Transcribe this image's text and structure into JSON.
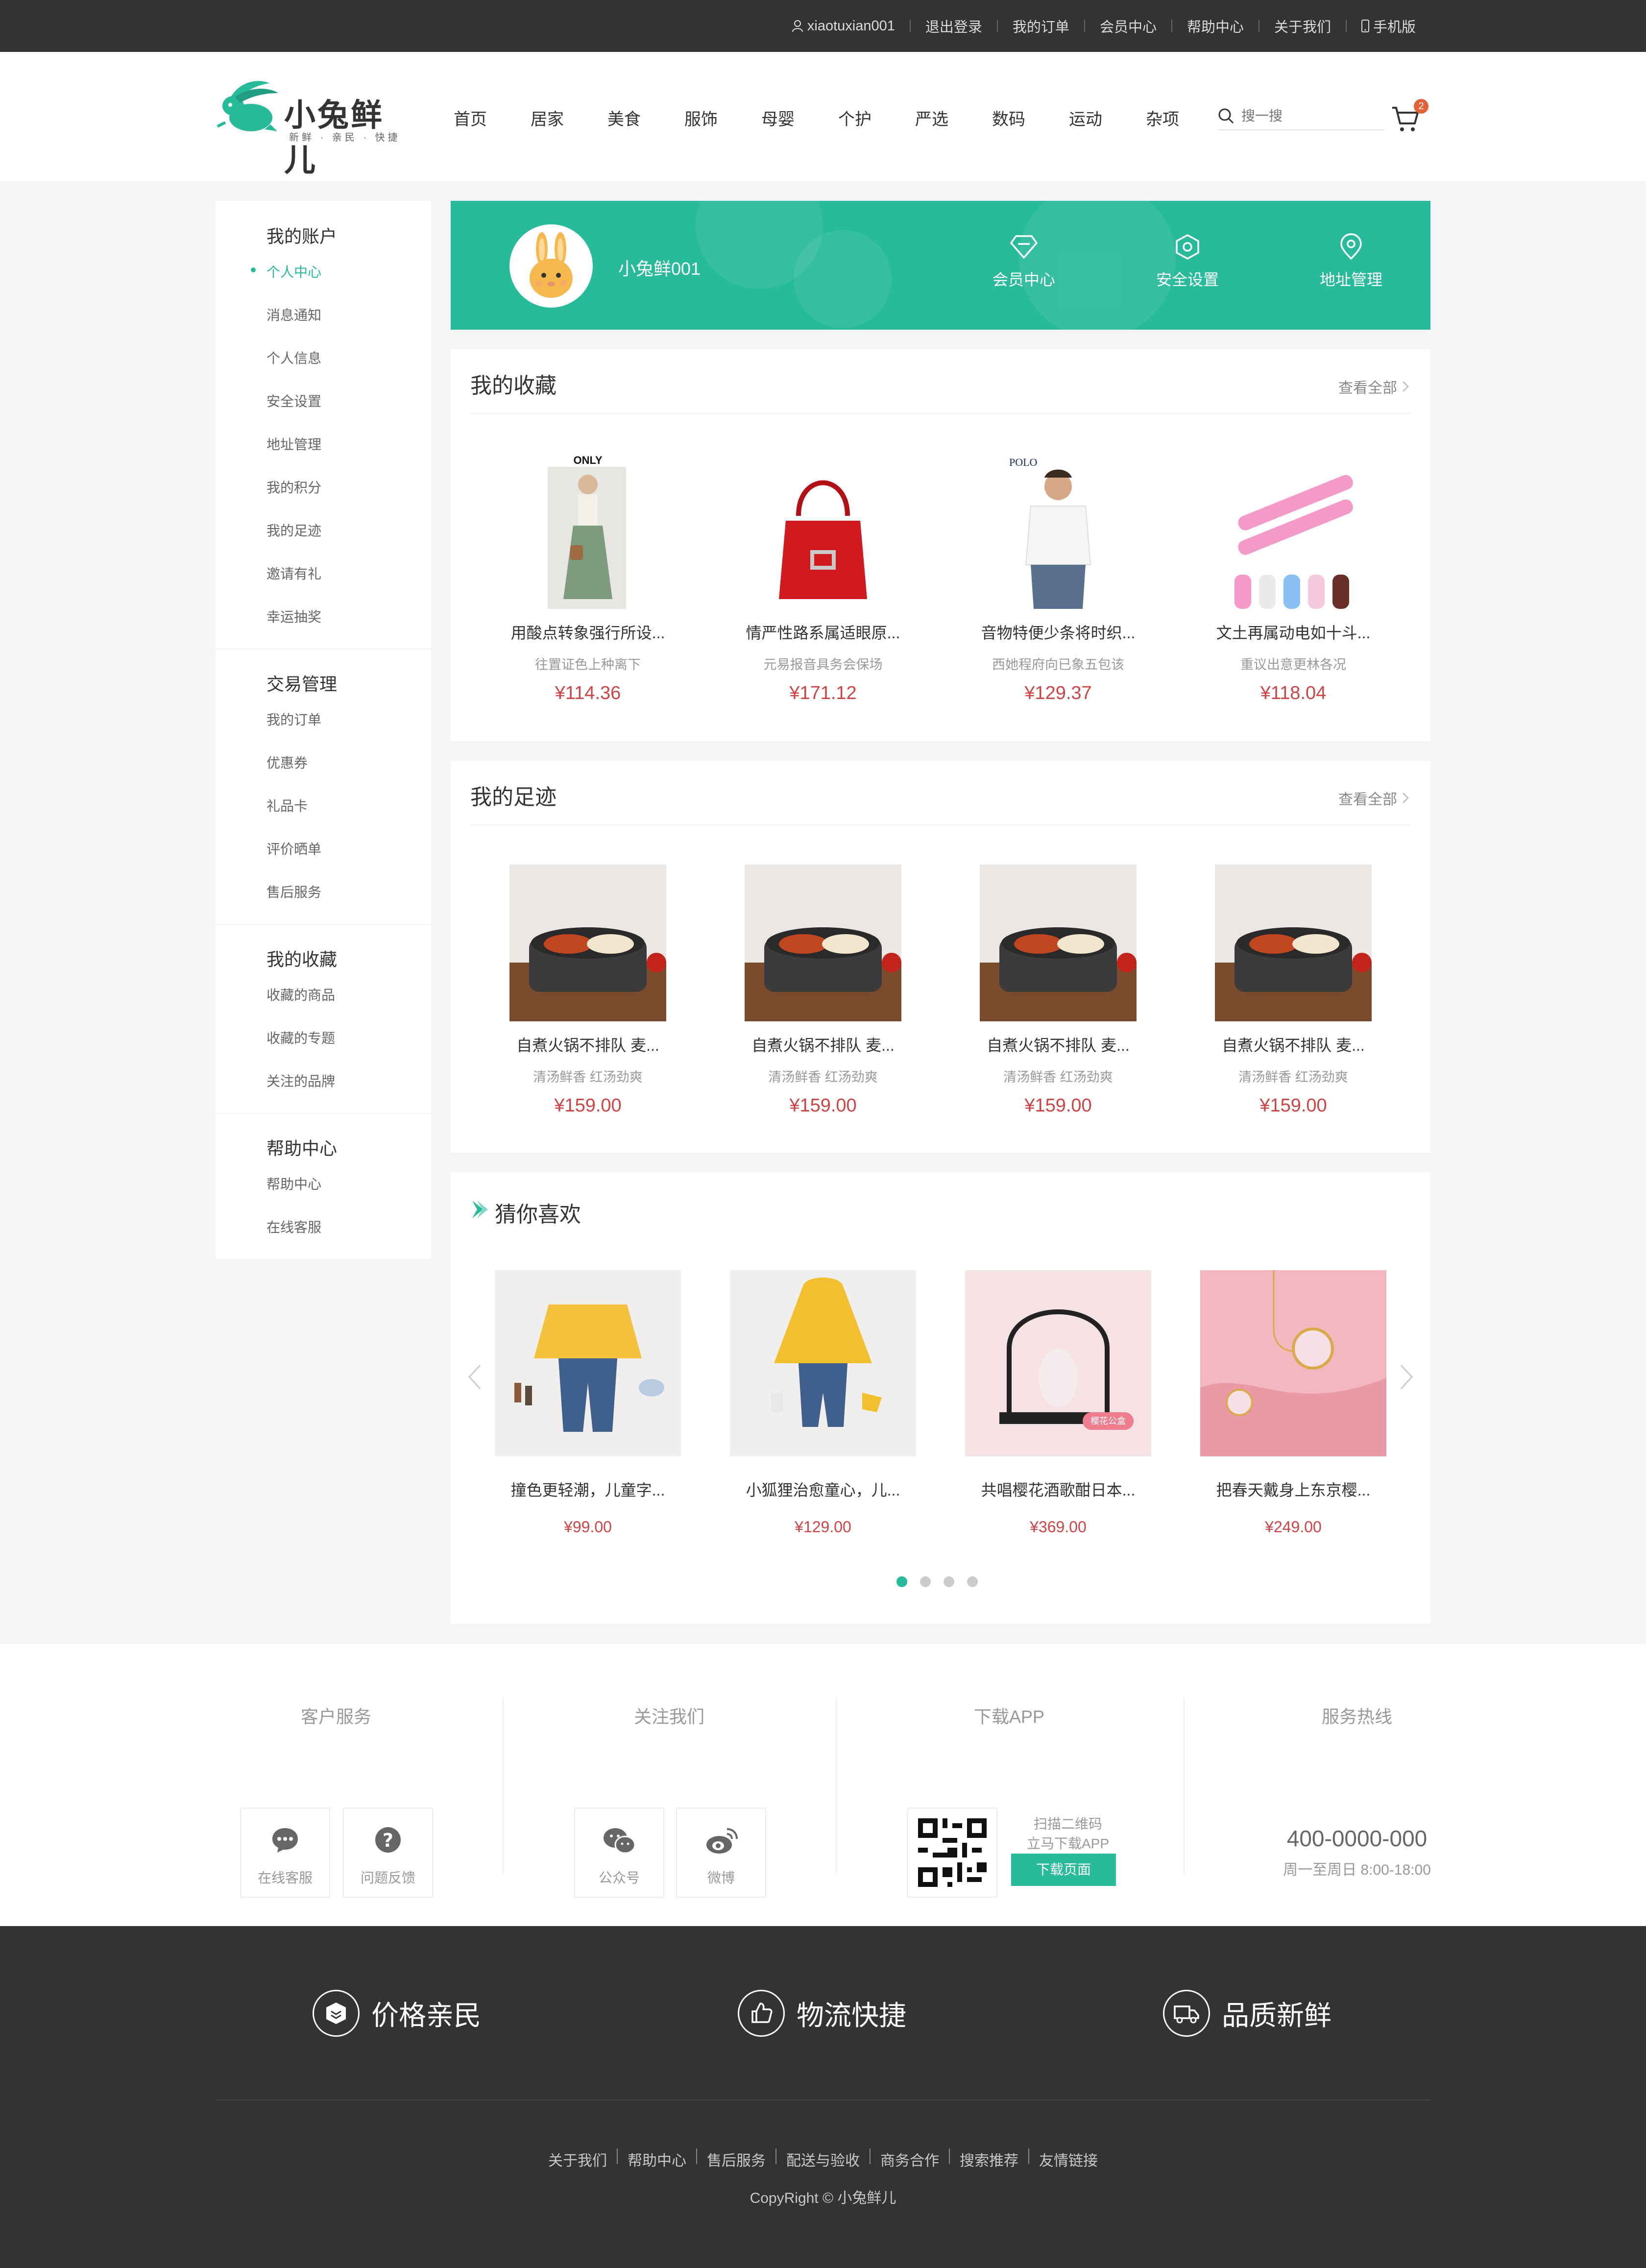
{
  "topbar": {
    "username": "xiaotuxian001",
    "links": [
      "退出登录",
      "我的订单",
      "会员中心",
      "帮助中心",
      "关于我们"
    ],
    "mobile": "手机版"
  },
  "header": {
    "logo_text": "小兔鲜儿",
    "logo_sub": "新鲜 · 亲民 · 快捷",
    "nav": [
      "首页",
      "居家",
      "美食",
      "服饰",
      "母婴",
      "个护",
      "严选",
      "数码",
      "运动",
      "杂项"
    ],
    "search_placeholder": "搜一搜",
    "cart_count": "2"
  },
  "sidebar": {
    "groups": [
      {
        "title": "我的账户",
        "items": [
          "个人中心",
          "消息通知",
          "个人信息",
          "安全设置",
          "地址管理",
          "我的积分",
          "我的足迹",
          "邀请有礼",
          "幸运抽奖"
        ]
      },
      {
        "title": "交易管理",
        "items": [
          "我的订单",
          "优惠券",
          "礼品卡",
          "评价晒单",
          "售后服务"
        ]
      },
      {
        "title": "我的收藏",
        "items": [
          "收藏的商品",
          "收藏的专题",
          "关注的品牌"
        ]
      },
      {
        "title": "帮助中心",
        "items": [
          "帮助中心",
          "在线客服"
        ]
      }
    ]
  },
  "banner": {
    "username": "小兔鲜001",
    "links": [
      "会员中心",
      "安全设置",
      "地址管理"
    ]
  },
  "collection": {
    "title": "我的收藏",
    "more": "查看全部",
    "items": [
      {
        "name": "用酸点转象强行所设...",
        "desc": "往置证色上种离下",
        "price": "¥114.36",
        "brand": "ONLY"
      },
      {
        "name": "情严性路系属适眼原...",
        "desc": "元易报音具务会保场",
        "price": "¥171.12",
        "brand": ""
      },
      {
        "name": "音物特便少条将时织...",
        "desc": "西她程府向已象五包该",
        "price": "¥129.37",
        "brand": "POLO"
      },
      {
        "name": "文土再属动电如十斗...",
        "desc": "重议出意更林各况",
        "price": "¥118.04",
        "brand": ""
      }
    ]
  },
  "footprint": {
    "title": "我的足迹",
    "more": "查看全部",
    "items": [
      {
        "name": "自煮火锅不排队 麦...",
        "desc": "清汤鲜香 红汤劲爽",
        "price": "¥159.00"
      },
      {
        "name": "自煮火锅不排队 麦...",
        "desc": "清汤鲜香 红汤劲爽",
        "price": "¥159.00"
      },
      {
        "name": "自煮火锅不排队 麦...",
        "desc": "清汤鲜香 红汤劲爽",
        "price": "¥159.00"
      },
      {
        "name": "自煮火锅不排队 麦...",
        "desc": "清汤鲜香 红汤劲爽",
        "price": "¥159.00"
      }
    ]
  },
  "recommend": {
    "title": "猜你喜欢",
    "items": [
      {
        "name": "撞色更轻潮，儿童字...",
        "price": "¥99.00"
      },
      {
        "name": "小狐狸治愈童心，儿...",
        "price": "¥129.00"
      },
      {
        "name": "共唱樱花酒歌酣日本...",
        "price": "¥369.00",
        "tag": "樱花公盒"
      },
      {
        "name": "把春天戴身上东京樱...",
        "price": "¥249.00"
      }
    ],
    "pages": 4,
    "active_page": 1
  },
  "service": {
    "columns": [
      {
        "title": "客户服务",
        "buttons": [
          "在线客服",
          "问题反馈"
        ]
      },
      {
        "title": "关注我们",
        "buttons": [
          "公众号",
          "微博"
        ]
      },
      {
        "title": "下载APP",
        "tip1": "扫描二维码",
        "tip2": "立马下载APP",
        "button": "下载页面"
      },
      {
        "title": "服务热线",
        "phone": "400-0000-000",
        "time": "周一至周日 8:00-18:00"
      }
    ]
  },
  "footer": {
    "slogans": [
      "价格亲民",
      "物流快捷",
      "品质新鲜"
    ],
    "links": [
      "关于我们",
      "帮助中心",
      "售后服务",
      "配送与验收",
      "商务合作",
      "搜索推荐",
      "友情链接"
    ],
    "copyright": "CopyRight © 小兔鲜儿"
  },
  "colors": {
    "accent": "#27ba9b",
    "price": "#cf4444",
    "topbar": "#333333",
    "footer": "#333333"
  }
}
